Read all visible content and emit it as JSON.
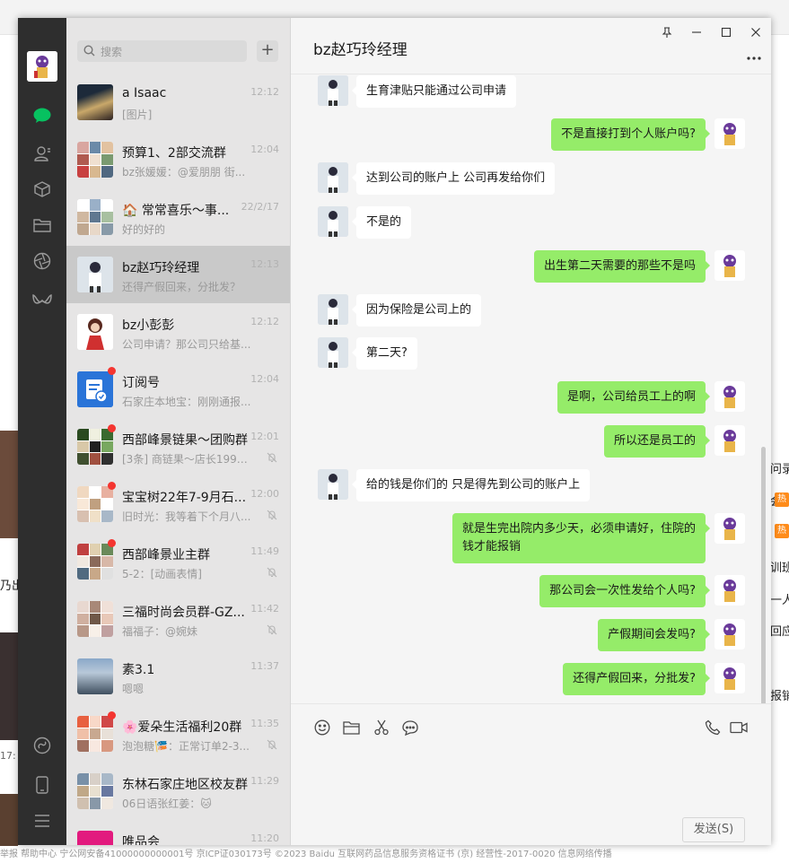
{
  "window": {
    "title": "bz赵巧玲经理"
  },
  "search": {
    "placeholder": "搜索"
  },
  "add_button": "+",
  "send_button": "发送(S)",
  "sidebar_icons": [
    "chat-icon",
    "contacts-icon",
    "favorites-icon",
    "files-icon",
    "moments-icon",
    "channels-icon",
    "mini-program-icon",
    "phone-icon",
    "menu-icon"
  ],
  "conversations": [
    {
      "name": "a  Isaac",
      "time": "12:12",
      "preview": "[图片]",
      "unread": false,
      "muted": false
    },
    {
      "name": "预算1、2部交流群",
      "time": "12:04",
      "preview": "bz张媛媛：@爱朋朋 街...",
      "unread": false,
      "muted": false
    },
    {
      "name": "🏠 常常喜乐～事...",
      "time": "22/2/17",
      "preview": "好的好的",
      "unread": false,
      "muted": false
    },
    {
      "name": "bz赵巧玲经理",
      "time": "12:13",
      "preview": "还得产假回来，分批发？",
      "unread": false,
      "muted": false,
      "active": true
    },
    {
      "name": "bz小彭彭",
      "time": "12:12",
      "preview": "公司申请？那公司只给基...",
      "unread": false,
      "muted": false
    },
    {
      "name": "订阅号",
      "time": "12:04",
      "preview": "石家庄本地宝：刚刚通报...",
      "unread": true,
      "muted": false
    },
    {
      "name": "西部峰景链果～团购群",
      "time": "12:01",
      "preview": "[3条] 商链果～店长1993...",
      "unread": true,
      "muted": true
    },
    {
      "name": "宝宝树22年7-9月石...",
      "time": "12:00",
      "preview": "旧时光：我等着下个月八...",
      "unread": true,
      "muted": true
    },
    {
      "name": "西部峰景业主群",
      "time": "11:49",
      "preview": "5-2：[动画表情]",
      "unread": true,
      "muted": true
    },
    {
      "name": "三福时尚会员群-GZ...",
      "time": "11:42",
      "preview": "福福子：@婉妹",
      "unread": false,
      "muted": true
    },
    {
      "name": "素3.1",
      "time": "11:37",
      "preview": "嗯嗯",
      "unread": false,
      "muted": false
    },
    {
      "name": "🌸爱朵生活福利20群",
      "time": "11:35",
      "preview": "泡泡糖🎏：正常订单2-3...",
      "unread": true,
      "muted": true
    },
    {
      "name": "东林石家庄地区校友群",
      "time": "11:29",
      "preview": "06日语张红姜：🐱",
      "unread": false,
      "muted": false
    },
    {
      "name": "唯品会",
      "time": "11:20",
      "preview": "",
      "unread": false,
      "muted": false
    }
  ],
  "messages": [
    {
      "dir": "in",
      "text": "生育津贴只能通过公司申请"
    },
    {
      "dir": "out",
      "text": "不是直接打到个人账户吗?"
    },
    {
      "dir": "in",
      "text": "达到公司的账户上 公司再发给你们"
    },
    {
      "dir": "in",
      "text": "不是的"
    },
    {
      "dir": "out",
      "text": "出生第二天需要的那些不是吗"
    },
    {
      "dir": "in",
      "text": "因为保险是公司上的"
    },
    {
      "dir": "in",
      "text": "第二天?"
    },
    {
      "dir": "out",
      "text": "是啊，公司给员工上的啊"
    },
    {
      "dir": "out",
      "text": "所以还是员工的"
    },
    {
      "dir": "in",
      "text": "给的钱是你们的  只是得先到公司的账户上"
    },
    {
      "dir": "out",
      "text": "就是生完出院内多少天，必须申请好，住院的钱才能报销"
    },
    {
      "dir": "out",
      "text": "那公司会一次性发给个人吗?"
    },
    {
      "dir": "out",
      "text": "产假期间会发吗?"
    },
    {
      "dir": "out",
      "text": "还得产假回来，分批发?"
    }
  ],
  "input_tools": [
    "emoji-icon",
    "folder-icon",
    "scissors-icon",
    "chat-history-icon",
    "phone-call-icon",
    "video-call-icon"
  ],
  "background": {
    "right_fragments": [
      "问录",
      "会",
      "训班",
      "一人",
      "回应",
      "报销"
    ],
    "left_fragments": [
      "乃出",
      "17:"
    ],
    "hot_badge": "热",
    "footer": "举报   帮助中心   宁公网安备41000000000001号   京ICP证030173号   ©2023 Baidu   互联网药品信息服务资格证书 (京) 经营性-2017-0020   信息网络传播"
  },
  "colors": {
    "sidebar": "#2e2e2e",
    "accent_green": "#07c160",
    "bubble_out": "#95ec69",
    "unread_dot": "#f43530"
  }
}
